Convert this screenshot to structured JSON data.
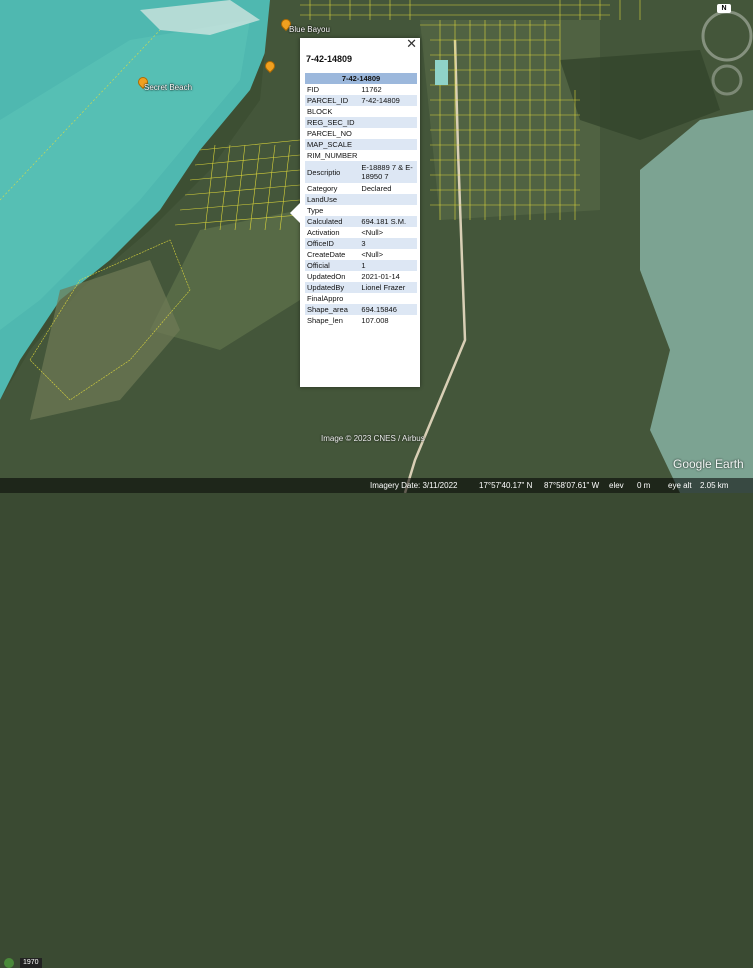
{
  "map": {
    "places": [
      {
        "name": "Blue Bayou"
      },
      {
        "name": "Secret Beach"
      }
    ],
    "compass_label": "N"
  },
  "popup": {
    "title": "7-42-14809",
    "close_glyph": "✕",
    "table_header": "7-42-14809",
    "rows": [
      {
        "key": "FID",
        "value": "11762"
      },
      {
        "key": "PARCEL_ID",
        "value": "7-42-14809"
      },
      {
        "key": "BLOCK",
        "value": ""
      },
      {
        "key": "REG_SEC_ID",
        "value": ""
      },
      {
        "key": "PARCEL_NO",
        "value": ""
      },
      {
        "key": "MAP_SCALE",
        "value": ""
      },
      {
        "key": "RIM_NUMBER",
        "value": ""
      },
      {
        "key": "Descriptio",
        "value": "E-18889 7 & E-18950 7"
      },
      {
        "key": "Category",
        "value": "Declared"
      },
      {
        "key": "LandUse",
        "value": ""
      },
      {
        "key": "Type",
        "value": ""
      },
      {
        "key": "Calculated",
        "value": "694.181 S.M."
      },
      {
        "key": "Activation",
        "value": "<Null>"
      },
      {
        "key": "OfficeID",
        "value": "3"
      },
      {
        "key": "CreateDate",
        "value": "<Null>"
      },
      {
        "key": "Official",
        "value": "1"
      },
      {
        "key": "UpdatedOn",
        "value": "2021-01-14"
      },
      {
        "key": "UpdatedBy",
        "value": "Lionel Frazer"
      },
      {
        "key": "FinalAppro",
        "value": ""
      },
      {
        "key": "Shape_area",
        "value": "694.15846"
      },
      {
        "key": "Shape_len",
        "value": "107.008"
      }
    ]
  },
  "credit": "Image © 2023 CNES / Airbus",
  "logo": "Google Earth",
  "status": {
    "year": "1970",
    "imagery_date": "Imagery Date: 3/11/2022",
    "lat": "17°57'40.17\" N",
    "lon": "87°58'07.61\" W",
    "elev": "elev",
    "elev_val": "0 m",
    "eye_alt": "eye alt",
    "eye_alt_val": "2.05 km"
  },
  "colors": {
    "sea": "#4fb8b0",
    "shallow": "#8fd3c8",
    "land": "#3d4f33",
    "parcel_lines": "#e8e03a",
    "popup_header": "#9cb8dc",
    "popup_alt_row": "#dde7f4"
  }
}
